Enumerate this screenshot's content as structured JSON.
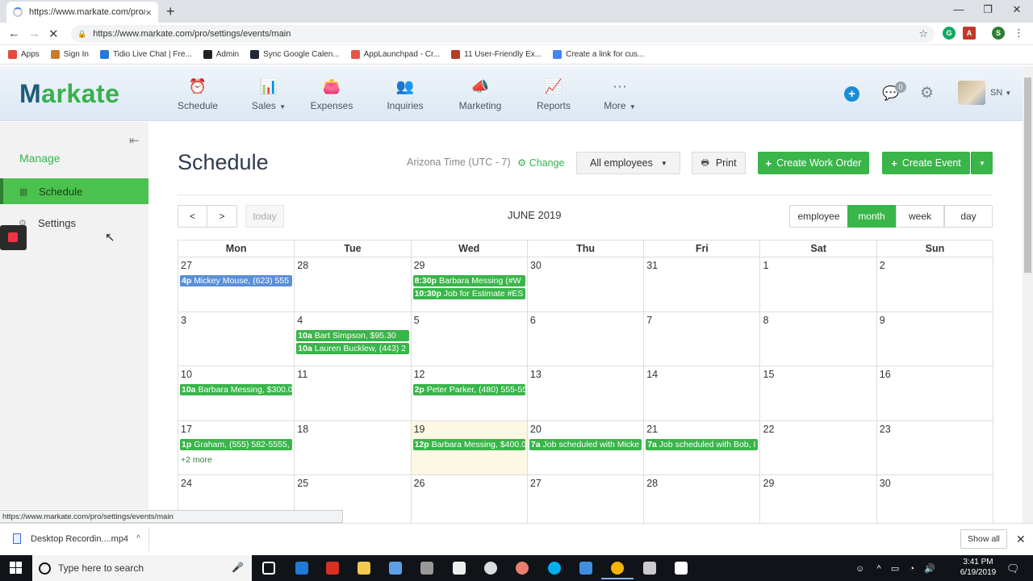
{
  "browser": {
    "tab_title": "https://www.markate.com/pro/sc",
    "tab_close": "×",
    "new_tab": "+",
    "url": "https://www.markate.com/pro/settings/events/main",
    "status_url": "https://www.markate.com/pro/settings/events/main",
    "ext_s": "S",
    "bookmarks": [
      {
        "label": "Apps",
        "color": "#e34b3c"
      },
      {
        "label": "Sign In",
        "color": "#c77c2b"
      },
      {
        "label": "Tidio Live Chat | Fre...",
        "color": "#2a78d6"
      },
      {
        "label": "Admin",
        "color": "#222222"
      },
      {
        "label": "Sync Google Calen...",
        "color": "#1f2a38"
      },
      {
        "label": "AppLaunchpad - Cr...",
        "color": "#e3564a"
      },
      {
        "label": "11 User-Friendly Ex...",
        "color": "#b53c2a"
      },
      {
        "label": "Create a link for cus...",
        "color": "#4285f4"
      }
    ]
  },
  "header": {
    "logo_m": "M",
    "logo_rest": "arkate",
    "nav": [
      {
        "label": "Schedule",
        "icon": "alarm-clock-icon",
        "glyph": "⏰"
      },
      {
        "label": "Sales",
        "icon": "bar-chart-icon",
        "glyph": "📊",
        "dropdown": true
      },
      {
        "label": "Expenses",
        "icon": "wallet-icon",
        "glyph": "👛"
      },
      {
        "label": "Inquiries",
        "icon": "people-icon",
        "glyph": "👥"
      },
      {
        "label": "Marketing",
        "icon": "megaphone-icon",
        "glyph": "📣"
      },
      {
        "label": "Reports",
        "icon": "line-chart-icon",
        "glyph": "📈"
      },
      {
        "label": "More",
        "icon": "ellipsis-circle-icon",
        "glyph": "⋯",
        "dropdown": true
      }
    ],
    "chat_count": "0",
    "user_initials": "SN"
  },
  "sidebar": {
    "section": "Manage",
    "items": [
      {
        "label": "Schedule",
        "icon": "calendar-icon",
        "active": true
      },
      {
        "label": "Settings",
        "icon": "gear-icon",
        "active": false
      }
    ]
  },
  "main": {
    "title": "Schedule",
    "timezone": "Arizona Time (UTC - 7)",
    "change_label": "Change",
    "employee_select": "All employees",
    "print_label": "Print",
    "create_work_order": "Create Work Order",
    "create_event": "Create Event"
  },
  "calendar": {
    "month_label": "JUNE 2019",
    "today_label": "today",
    "views": [
      "employee",
      "month",
      "week",
      "day"
    ],
    "active_view": "month",
    "weekdays": [
      "Mon",
      "Tue",
      "Wed",
      "Thu",
      "Fri",
      "Sat",
      "Sun"
    ],
    "weeks": [
      [
        {
          "day": "27",
          "events": [
            {
              "time": "4p",
              "text": "Mickey Mouse, (623) 555",
              "color": "blue"
            }
          ]
        },
        {
          "day": "28",
          "events": []
        },
        {
          "day": "29",
          "events": [
            {
              "time": "8:30p",
              "text": "Barbara Messing (#W",
              "color": "green"
            },
            {
              "time": "10:30p",
              "text": "Job for Estimate #ES",
              "color": "green"
            }
          ]
        },
        {
          "day": "30",
          "events": []
        },
        {
          "day": "31",
          "events": []
        },
        {
          "day": "1",
          "events": []
        },
        {
          "day": "2",
          "events": []
        }
      ],
      [
        {
          "day": "3",
          "events": []
        },
        {
          "day": "4",
          "events": [
            {
              "time": "10a",
              "text": "Bart Simpson, $95.30",
              "color": "green"
            },
            {
              "time": "10a",
              "text": "Lauren Bucklew, (443) 2",
              "color": "green"
            }
          ]
        },
        {
          "day": "5",
          "events": []
        },
        {
          "day": "6",
          "events": []
        },
        {
          "day": "7",
          "events": []
        },
        {
          "day": "8",
          "events": []
        },
        {
          "day": "9",
          "events": []
        }
      ],
      [
        {
          "day": "10",
          "events": [
            {
              "time": "10a",
              "text": "Barbara Messing, $300.0",
              "color": "green"
            }
          ]
        },
        {
          "day": "11",
          "events": []
        },
        {
          "day": "12",
          "events": [
            {
              "time": "2p",
              "text": "Peter Parker, (480) 555-55",
              "color": "green"
            }
          ]
        },
        {
          "day": "13",
          "events": []
        },
        {
          "day": "14",
          "events": []
        },
        {
          "day": "15",
          "events": []
        },
        {
          "day": "16",
          "events": []
        }
      ],
      [
        {
          "day": "17",
          "events": [
            {
              "time": "1p",
              "text": "Graham, (555) 582-5555,",
              "color": "green"
            }
          ],
          "more": "+2 more"
        },
        {
          "day": "18",
          "events": []
        },
        {
          "day": "19",
          "events": [
            {
              "time": "12p",
              "text": "Barbara Messing, $400.0",
              "color": "green"
            }
          ],
          "today": true
        },
        {
          "day": "20",
          "events": [
            {
              "time": "7a",
              "text": "Job scheduled with Micke",
              "color": "green"
            }
          ]
        },
        {
          "day": "21",
          "events": [
            {
              "time": "7a",
              "text": "Job scheduled with Bob, I",
              "color": "green"
            }
          ]
        },
        {
          "day": "22",
          "events": []
        },
        {
          "day": "23",
          "events": []
        }
      ],
      [
        {
          "day": "24",
          "events": []
        },
        {
          "day": "25",
          "events": []
        },
        {
          "day": "26",
          "events": []
        },
        {
          "day": "27",
          "events": []
        },
        {
          "day": "28",
          "events": []
        },
        {
          "day": "29",
          "events": []
        },
        {
          "day": "30",
          "events": []
        }
      ]
    ]
  },
  "downloads": {
    "file": "Desktop Recordin....mp4",
    "show_all": "Show all"
  },
  "taskbar": {
    "search_placeholder": "Type here to search",
    "time": "3:41 PM",
    "date": "6/19/2019"
  }
}
